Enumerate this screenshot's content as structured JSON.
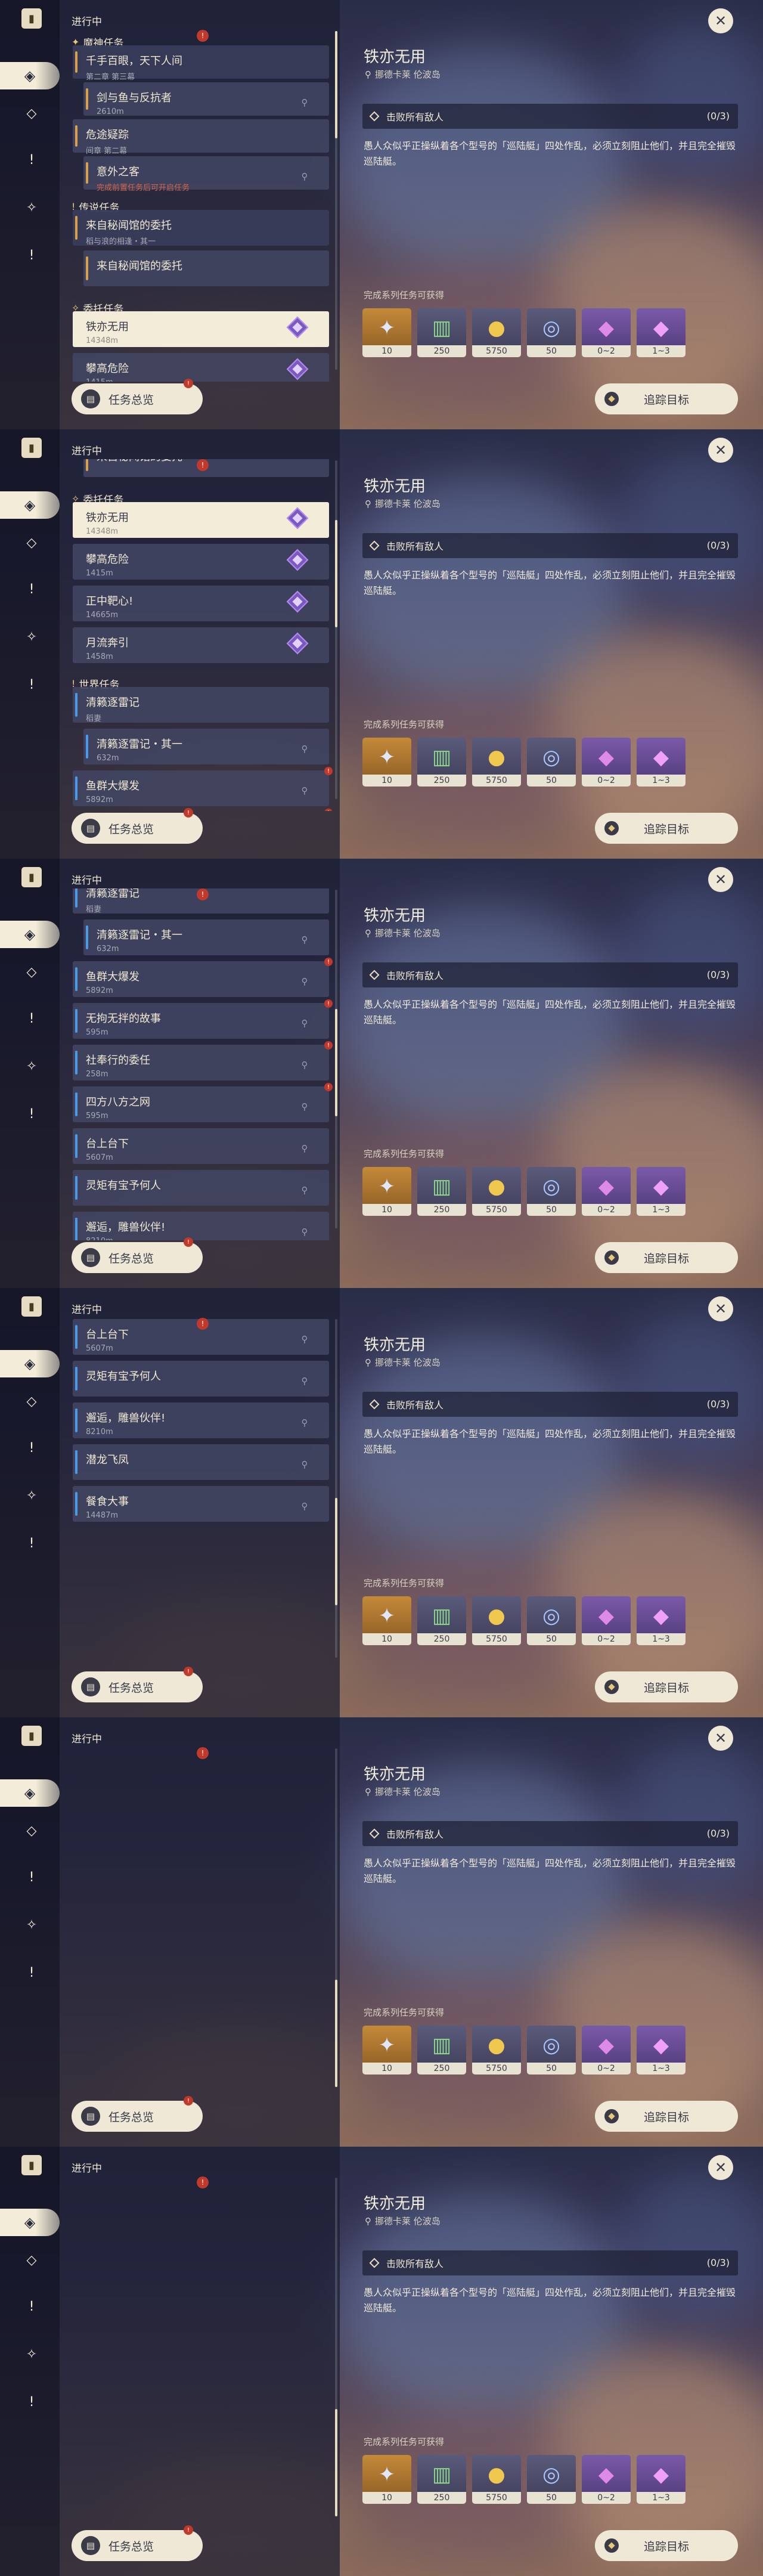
{
  "panel": {
    "in_progress": "进行中",
    "overview_label": "任务总览",
    "overview_badge": "!",
    "marker": "!"
  },
  "icons": {
    "book": "book-icon",
    "sidebar": [
      "quest-diamond-icon",
      "compass-icon",
      "exclamation-icon",
      "world-icon",
      "alert-icon"
    ],
    "close": "close-icon",
    "pin": "location-pin-icon",
    "track": "track-target-icon"
  },
  "quest_list": {
    "archon_header": "魔神任务",
    "legend_header": "传说任务",
    "commission_header": "委托任务",
    "world_header": "世界任务",
    "archon": [
      {
        "title": "千手百眼，天下人间",
        "sub": "第二章 第三幕"
      },
      {
        "title": "剑与鱼与反抗者",
        "sub": "2610m"
      },
      {
        "title": "危途疑踪",
        "sub": "间章 第二幕"
      },
      {
        "title": "意外之客",
        "sub": "完成前置任务后可开启任务"
      }
    ],
    "legend": [
      {
        "title": "来自秘闻馆的委托",
        "sub": "稻与浪的相逢・其一"
      },
      {
        "title": "来自秘闻馆的委托",
        "sub": ""
      }
    ],
    "commission": [
      {
        "title": "铁亦无用",
        "sub": "14348m"
      },
      {
        "title": "攀高危险",
        "sub": "1415m"
      },
      {
        "title": "正中靶心!",
        "sub": "14665m"
      },
      {
        "title": "月流奔引",
        "sub": "1458m"
      }
    ],
    "world": [
      {
        "title": "清籁逐雷记",
        "sub": "稻妻"
      },
      {
        "title": "清籁逐雷记・其一",
        "sub": "632m"
      },
      {
        "title": "鱼群大爆发",
        "sub": "5892m"
      },
      {
        "title": "无拘无拌的故事",
        "sub": "595m"
      },
      {
        "title": "社奉行的委任",
        "sub": "258m"
      },
      {
        "title": "四方八方之网",
        "sub": "595m"
      },
      {
        "title": "台上台下",
        "sub": "5607m"
      },
      {
        "title": "灵矩有宝予何人",
        "sub": ""
      },
      {
        "title": "邂逅，雕兽伙伴!",
        "sub": "8210m"
      },
      {
        "title": "潜龙飞凤",
        "sub": ""
      },
      {
        "title": "餐食大事",
        "sub": "14487m"
      }
    ]
  },
  "detail": {
    "title": "铁亦无用",
    "location": "挪德卡莱 伦波岛",
    "objective": "击败所有敌人",
    "objective_count": "(0/3)",
    "description": "愚人众似乎正操纵着各个型号的「巡陆艇」四处作乱，必须立刻阻止他们，并且完全摧毁巡陆艇。",
    "rewards_label": "完成系列任务可获得",
    "rewards": [
      {
        "icon": "adventure-exp-icon",
        "amount": "10"
      },
      {
        "icon": "character-exp-icon",
        "amount": "250"
      },
      {
        "icon": "mora-icon",
        "amount": "5750"
      },
      {
        "icon": "companionship-exp-icon",
        "amount": "50"
      },
      {
        "icon": "crystal-chunk-icon",
        "amount": "0~2"
      },
      {
        "icon": "crystal-cluster-icon",
        "amount": "1~3"
      }
    ],
    "track_label": "追踪目标"
  }
}
